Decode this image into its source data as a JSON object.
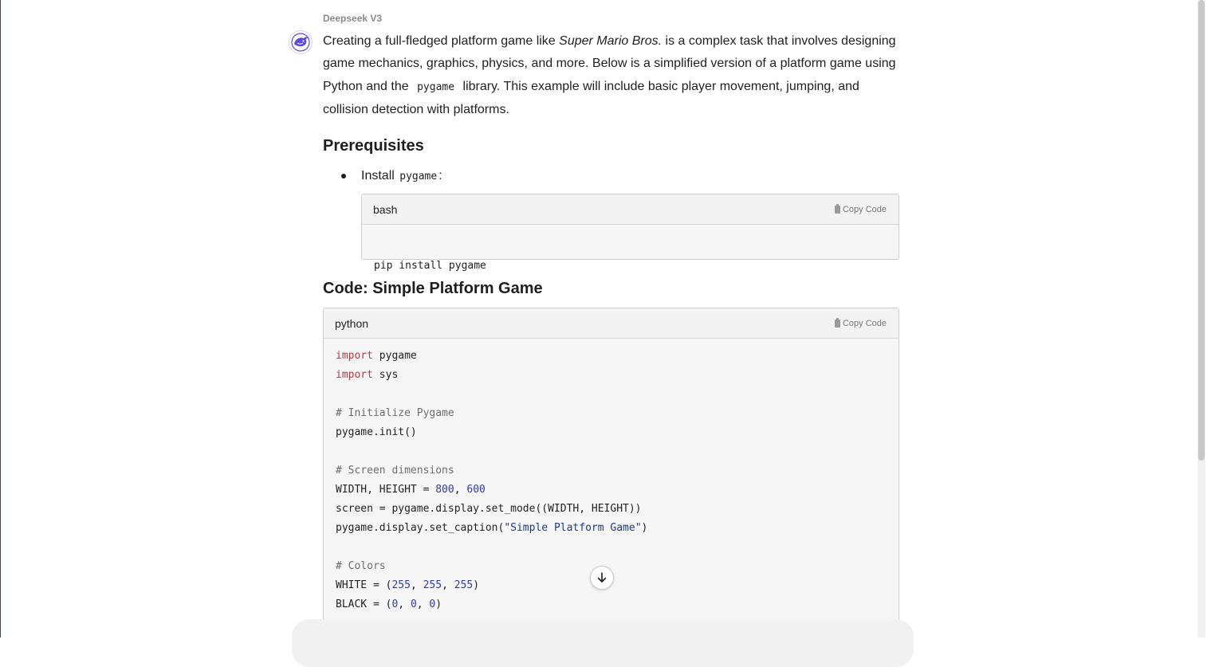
{
  "message": {
    "model_name": "Deepseek V3",
    "intro_part1": "Creating a full-fledged platform game like ",
    "intro_em": "Super Mario Bros.",
    "intro_part2": " is a complex task that involves designing game mechanics, graphics, physics, and more. Below is a simplified version of a platform game using Python and the ",
    "intro_code": "pygame",
    "intro_part3": " library. This example will include basic player movement, jumping, and collision detection with platforms."
  },
  "prereq": {
    "heading": "Prerequisites",
    "bullet_text": "Install ",
    "bullet_code": "pygame",
    "bullet_suffix": ":"
  },
  "bash_block": {
    "lang": "bash",
    "copy_label": "Copy Code",
    "code": "pip install pygame"
  },
  "game_section": {
    "heading": "Code: Simple Platform Game"
  },
  "python_block": {
    "lang": "python",
    "copy_label": "Copy Code",
    "lines": [
      [
        {
          "t": "kw",
          "v": "import"
        },
        {
          "t": "",
          "v": " pygame"
        }
      ],
      [
        {
          "t": "kw",
          "v": "import"
        },
        {
          "t": "",
          "v": " sys"
        }
      ],
      [],
      [
        {
          "t": "cm",
          "v": "# Initialize Pygame"
        }
      ],
      [
        {
          "t": "",
          "v": "pygame.init()"
        }
      ],
      [],
      [
        {
          "t": "cm",
          "v": "# Screen dimensions"
        }
      ],
      [
        {
          "t": "",
          "v": "WIDTH, HEIGHT = "
        },
        {
          "t": "num",
          "v": "800"
        },
        {
          "t": "",
          "v": ", "
        },
        {
          "t": "num",
          "v": "600"
        }
      ],
      [
        {
          "t": "",
          "v": "screen = pygame.display.set_mode((WIDTH, HEIGHT))"
        }
      ],
      [
        {
          "t": "",
          "v": "pygame.display.set_caption("
        },
        {
          "t": "str",
          "v": "\"Simple Platform Game\""
        },
        {
          "t": "",
          "v": ")"
        }
      ],
      [],
      [
        {
          "t": "cm",
          "v": "# Colors"
        }
      ],
      [
        {
          "t": "",
          "v": "WHITE = ("
        },
        {
          "t": "num",
          "v": "255"
        },
        {
          "t": "",
          "v": ", "
        },
        {
          "t": "num",
          "v": "255"
        },
        {
          "t": "",
          "v": ", "
        },
        {
          "t": "num",
          "v": "255"
        },
        {
          "t": "",
          "v": ")"
        }
      ],
      [
        {
          "t": "",
          "v": "BLACK = ("
        },
        {
          "t": "num",
          "v": "0"
        },
        {
          "t": "",
          "v": ", "
        },
        {
          "t": "num",
          "v": "0"
        },
        {
          "t": "",
          "v": ", "
        },
        {
          "t": "num",
          "v": "0"
        },
        {
          "t": "",
          "v": ")"
        }
      ]
    ]
  },
  "icons": {
    "avatar": "deepseek-whale-icon",
    "copy": "clipboard-icon",
    "scroll_down": "arrow-down-icon"
  },
  "colors": {
    "avatar_accent": "#5b4bdb",
    "keyword": "#c0363e",
    "number": "#2d3bb0",
    "comment": "#6e6e6e"
  }
}
